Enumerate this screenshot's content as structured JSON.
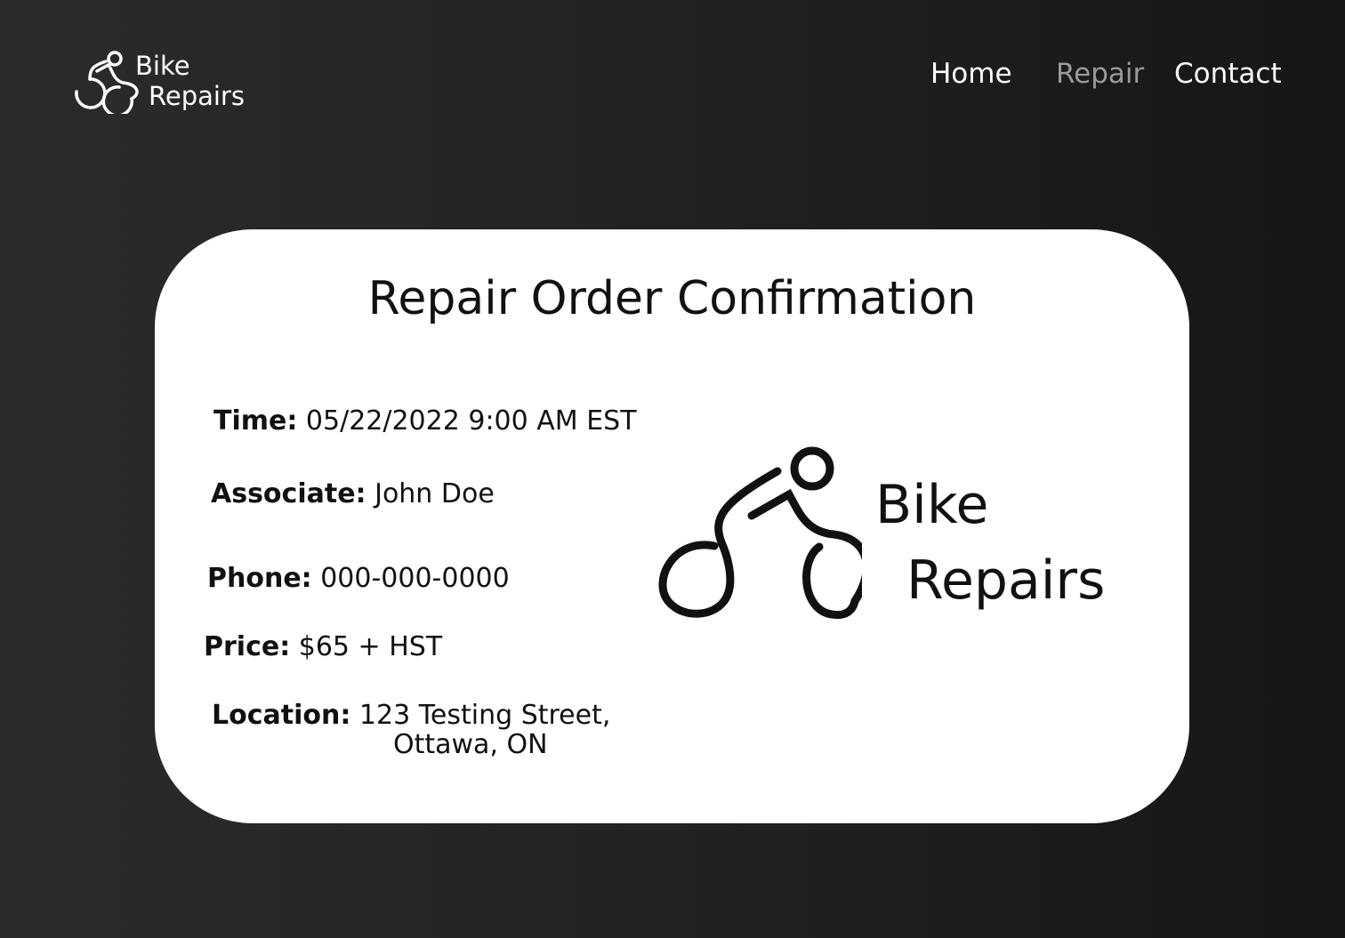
{
  "brand": {
    "line1": "Bike",
    "line2": "Repairs",
    "icon": "cyclist-icon"
  },
  "nav": {
    "home": "Home",
    "repair": "Repair",
    "contact": "Contact",
    "active": "Repair"
  },
  "card": {
    "title": "Repair Order Confirmation",
    "time_label": "Time:",
    "time_value": "05/22/2022 9:00 AM EST",
    "associate_label": "Associate:",
    "associate_value": "John Doe",
    "phone_label": "Phone:",
    "phone_value": "000-000-0000",
    "price_label": "Price:",
    "price_value": "$65 + HST",
    "location_label": "Location:",
    "location_line1": "123 Testing Street,",
    "location_line2": "Ottawa, ON",
    "logo_line1": "Bike",
    "logo_line2": "Repairs"
  },
  "colors": {
    "background_left": "#2b2b2b",
    "background_right": "#161616",
    "card": "#ffffff",
    "text": "#111111",
    "nav_active": "#9a9a9a"
  }
}
